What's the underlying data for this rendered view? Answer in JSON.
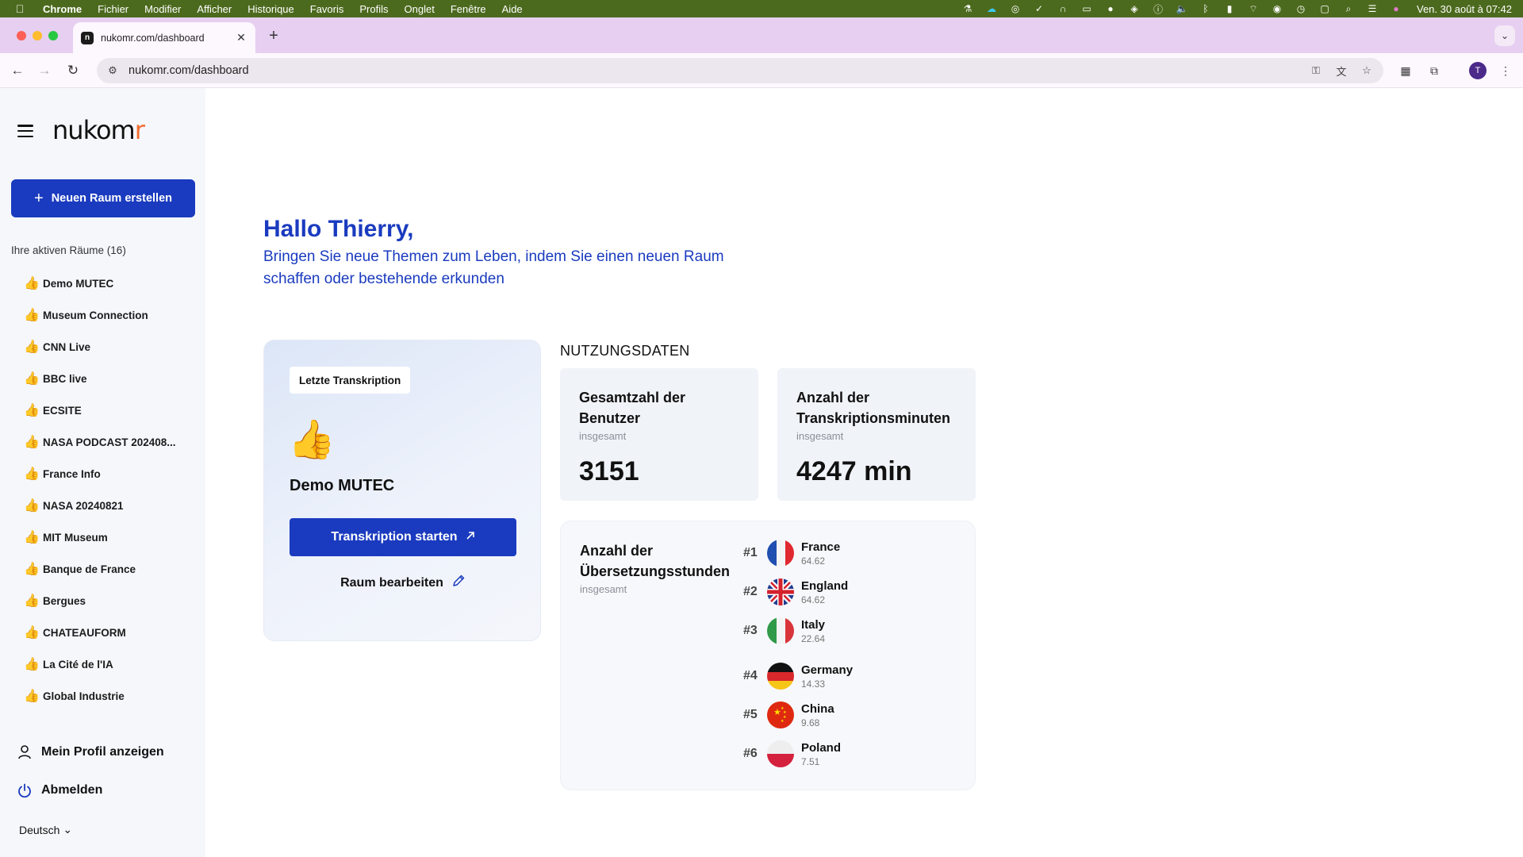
{
  "menubar": {
    "app": "Chrome",
    "items": [
      "Fichier",
      "Modifier",
      "Afficher",
      "Historique",
      "Favoris",
      "Profils",
      "Onglet",
      "Fenêtre",
      "Aide"
    ],
    "clock": "Ven. 30 août à 07:42"
  },
  "browser": {
    "tab_title": "nukomr.com/dashboard",
    "url": "nukomr.com/dashboard",
    "avatar_letter": "T"
  },
  "sidebar": {
    "logo": "nukomr",
    "new_room_label": "Neuen Raum erstellen",
    "active_rooms_label": "Ihre aktiven Räume (16)",
    "rooms": [
      {
        "emoji": "👍",
        "name": "Demo MUTEC"
      },
      {
        "emoji": "👍",
        "name": "Museum Connection"
      },
      {
        "emoji": "👍",
        "name": "CNN Live"
      },
      {
        "emoji": "👍",
        "name": "BBC live"
      },
      {
        "emoji": "👍",
        "name": "ECSITE"
      },
      {
        "emoji": "👍",
        "name": "NASA PODCAST 202408..."
      },
      {
        "emoji": "👍",
        "name": "France Info"
      },
      {
        "emoji": "👍",
        "name": "NASA 20240821"
      },
      {
        "emoji": "👍",
        "name": "MIT Museum"
      },
      {
        "emoji": "👍",
        "name": "Banque de France"
      },
      {
        "emoji": "👍",
        "name": "Bergues"
      },
      {
        "emoji": "👍",
        "name": "CHATEAUFORM"
      },
      {
        "emoji": "👍",
        "name": "La Cité de l'IA"
      },
      {
        "emoji": "👍",
        "name": "Global Industrie"
      }
    ],
    "profile_label": "Mein Profil anzeigen",
    "logout_label": "Abmelden",
    "language": "Deutsch"
  },
  "main": {
    "greeting": "Hallo Thierry,",
    "subtitle": "Bringen Sie neue Themen zum Leben, indem Sie einen neuen Raum schaffen oder bestehende erkunden",
    "last_transcription": {
      "tag": "Letzte Transkription",
      "emoji": "👍",
      "room_name": "Demo MUTEC",
      "start_label": "Transkription starten",
      "edit_label": "Raum bearbeiten"
    },
    "usage": {
      "title": "NUTZUNGSDATEN",
      "users": {
        "label": "Gesamtzahl der Benutzer",
        "sub": "insgesamt",
        "value": "3151"
      },
      "minutes": {
        "label": "Anzahl der Transkriptionsminuten",
        "sub": "insgesamt",
        "value": "4247 min"
      },
      "hours": {
        "label": "Anzahl der Übersetzungsstunden",
        "sub": "insgesamt",
        "ranking": [
          {
            "rank": "#1",
            "country": "France",
            "value": "64.62",
            "flag": "france-flag-icon"
          },
          {
            "rank": "#2",
            "country": "England",
            "value": "64.62",
            "flag": "uk-flag-icon"
          },
          {
            "rank": "#3",
            "country": "Italy",
            "value": "22.64",
            "flag": "italy-flag-icon"
          },
          {
            "rank": "#4",
            "country": "Germany",
            "value": "14.33",
            "flag": "germany-flag-icon"
          },
          {
            "rank": "#5",
            "country": "China",
            "value": "9.68",
            "flag": "china-flag-icon"
          },
          {
            "rank": "#6",
            "country": "Poland",
            "value": "7.51",
            "flag": "poland-flag-icon"
          }
        ]
      }
    }
  },
  "colors": {
    "brand_blue": "#1a3bbf",
    "menubar_green": "#4c6a1e",
    "tabstrip_purple": "#e6cff0",
    "logo_accent": "#f06d30"
  }
}
